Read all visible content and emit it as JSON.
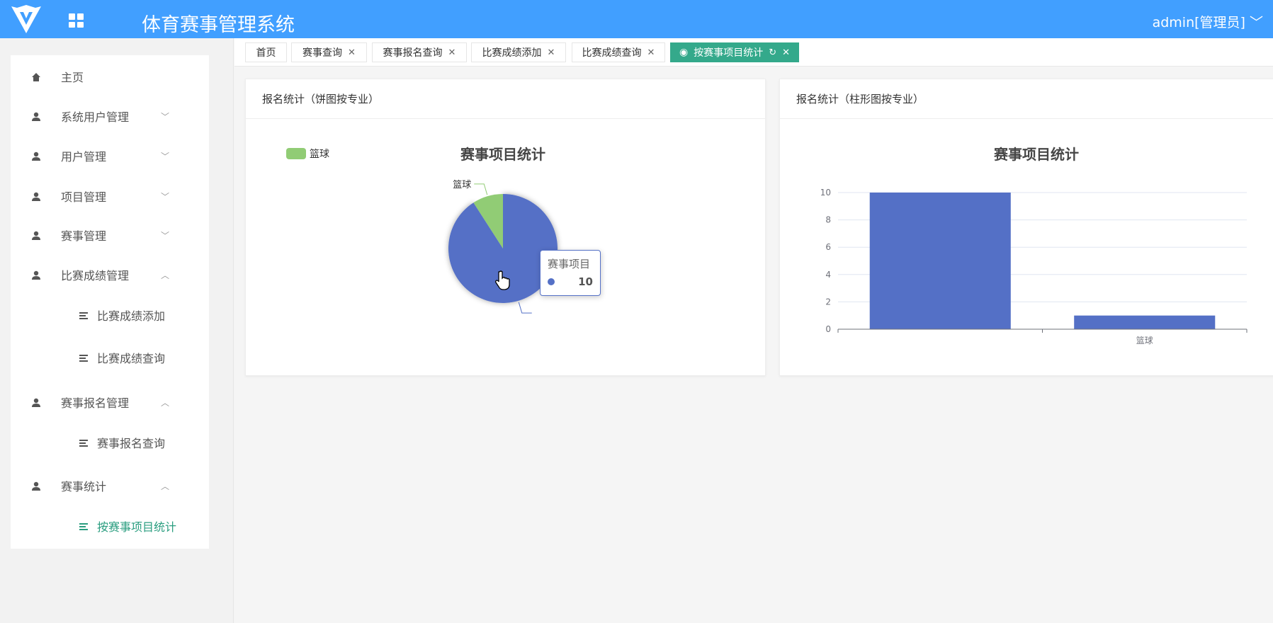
{
  "header": {
    "title": "体育赛事管理系统",
    "user": "admin[管理员]"
  },
  "sidebar": {
    "items": [
      {
        "label": "主页",
        "icon": "home-icon"
      },
      {
        "label": "系统用户管理",
        "icon": "user-icon",
        "chevron": "﹀"
      },
      {
        "label": "用户管理",
        "icon": "user-icon",
        "chevron": "﹀"
      },
      {
        "label": "项目管理",
        "icon": "user-icon",
        "chevron": "﹀"
      },
      {
        "label": "赛事管理",
        "icon": "user-icon",
        "chevron": "﹀"
      },
      {
        "label": "比赛成绩管理",
        "icon": "user-icon",
        "chevron": "︿"
      },
      {
        "label": "比赛成绩添加",
        "icon": "list-icon",
        "sub": true
      },
      {
        "label": "比赛成绩查询",
        "icon": "list-icon",
        "sub": true
      },
      {
        "label": "赛事报名管理",
        "icon": "user-icon",
        "chevron": "︿"
      },
      {
        "label": "赛事报名查询",
        "icon": "list-icon",
        "sub": true
      },
      {
        "label": "赛事统计",
        "icon": "user-icon",
        "chevron": "︿"
      },
      {
        "label": "按赛事项目统计",
        "icon": "list-icon",
        "sub": true,
        "active": true
      }
    ]
  },
  "tabs": [
    {
      "label": "首页"
    },
    {
      "label": "赛事查询",
      "close": "✕"
    },
    {
      "label": "赛事报名查询",
      "close": "✕"
    },
    {
      "label": "比赛成绩添加",
      "close": "✕"
    },
    {
      "label": "比赛成绩查询",
      "close": "✕"
    },
    {
      "label": "按赛事项目统计",
      "close": "✕",
      "refresh": "↻",
      "active": true
    }
  ],
  "cards": {
    "pie_title": "报名统计（饼图按专业）",
    "bar_title": "报名统计（柱形图按专业）"
  },
  "tooltip": {
    "series": "赛事项目",
    "value": "10"
  },
  "colors": {
    "header": "#419fff",
    "accent": "#34a98b",
    "blue": "#5470c6",
    "green": "#91cc75"
  },
  "chart_data": [
    {
      "type": "pie",
      "title": "赛事项目统计",
      "series_name": "赛事项目",
      "legend": [
        "篮球"
      ],
      "legend_position": "top-left",
      "slices": [
        {
          "name": "",
          "value": 10
        },
        {
          "name": "篮球",
          "value": 1
        }
      ]
    },
    {
      "type": "bar",
      "title": "赛事项目统计",
      "categories": [
        "",
        "篮球"
      ],
      "values": [
        10,
        1
      ],
      "ylim": [
        0,
        10
      ],
      "yticks": [
        0,
        2,
        4,
        6,
        8,
        10
      ],
      "grid": true
    }
  ]
}
